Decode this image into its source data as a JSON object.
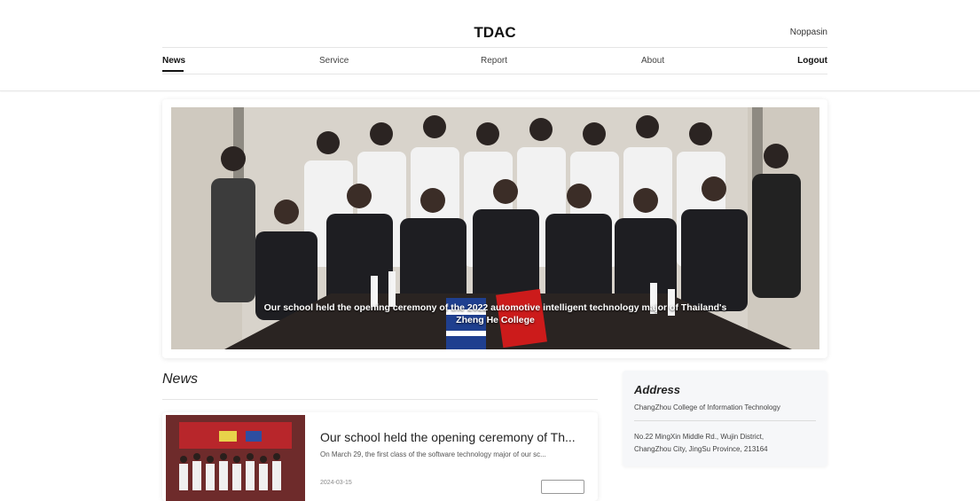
{
  "header": {
    "brand": "TDAC",
    "user_name": "Noppasin"
  },
  "nav": {
    "items": [
      {
        "label": "News",
        "active": true
      },
      {
        "label": "Service",
        "active": false
      },
      {
        "label": "Report",
        "active": false
      },
      {
        "label": "About",
        "active": false
      }
    ],
    "logout_label": "Logout"
  },
  "carousel": {
    "caption": "Our school held the opening ceremony of the 2022 automotive intelligent technology major of Thailand's Zheng He College"
  },
  "news": {
    "heading": "News",
    "items": [
      {
        "title": "Our school held the opening ceremony of Th...",
        "excerpt": "On March 29, the first class of the software technology major of our sc...",
        "date": "2024-03-15"
      }
    ]
  },
  "address": {
    "title": "Address",
    "org": "ChangZhou College of Information Technology",
    "line1": "No.22 MingXin Middle Rd., Wujin District,",
    "line2": "ChangZhou City, JingSu Province, 213164"
  },
  "colors": {
    "accent": "#111111",
    "card_bg": "#f6f7f9"
  }
}
